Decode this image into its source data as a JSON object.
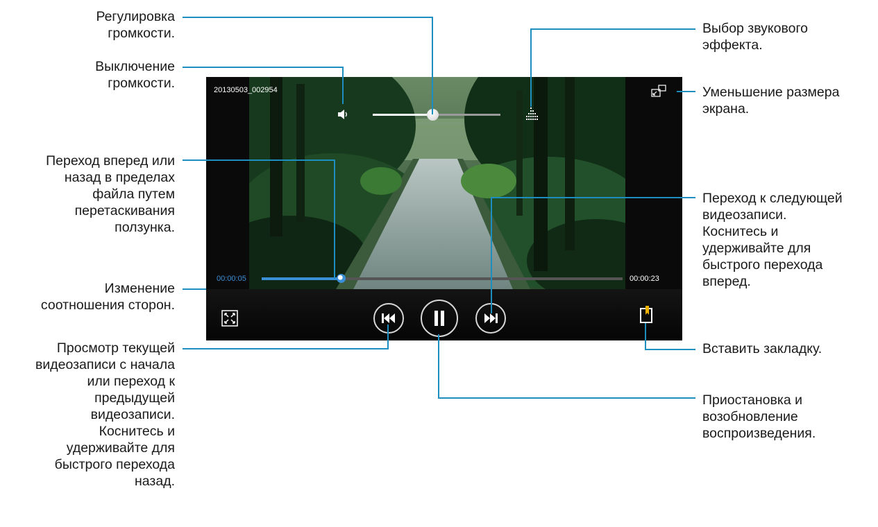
{
  "player": {
    "file_name": "20130503_002954",
    "elapsed_time": "00:00:05",
    "total_time": "00:00:23",
    "progress_fraction": 0.22,
    "volume_fraction": 0.47,
    "accent_color": "#3b8fd6",
    "icons": {
      "volume": "speaker-icon",
      "sound_effect": "equalizer-icon",
      "pop_up": "pop-up-player-icon",
      "aspect_ratio": "aspect-ratio-icon",
      "previous": "previous-track-icon",
      "pause": "pause-icon",
      "next": "next-track-icon",
      "bookmark": "bookmark-icon"
    }
  },
  "callouts": {
    "volume_adjust": "Регулировка\nгромкости.",
    "mute": "Выключение\nгромкости.",
    "seek": "Переход вперед или\nназад в пределах\nфайла путем\nперетаскивания\nползунка.",
    "aspect_ratio": "Изменение\nсоотношения сторон.",
    "previous": "Просмотр текущей\nвидеозаписи с начала\nили переход к\nпредыдущей\nвидеозаписи.\nКоснитесь и\nудерживайте для\nбыстрого перехода\nназад.",
    "sound_effect": "Выбор звукового\nэффекта.",
    "reduce_screen": "Уменьшение размера\nэкрана.",
    "next": "Переход к следующей\nвидеозаписи.\nКоснитесь и\nудерживайте для\nбыстрого перехода\nвперед.",
    "bookmark": "Вставить закладку.",
    "pause_resume": "Приостановка и\nвозобновление\nвоспроизведения."
  }
}
